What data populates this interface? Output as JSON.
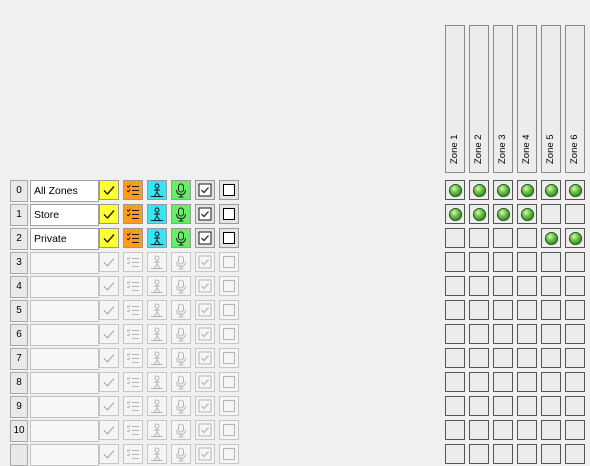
{
  "zones": [
    "Zone 1",
    "Zone 2",
    "Zone 3",
    "Zone 4",
    "Zone 5",
    "Zone 6"
  ],
  "rows": [
    {
      "index": "0",
      "name": "All Zones",
      "active": true,
      "zones": [
        true,
        true,
        true,
        true,
        true,
        true
      ]
    },
    {
      "index": "1",
      "name": "Store",
      "active": true,
      "zones": [
        true,
        true,
        true,
        true,
        false,
        false
      ]
    },
    {
      "index": "2",
      "name": "Private",
      "active": true,
      "zones": [
        false,
        false,
        false,
        false,
        true,
        true
      ]
    },
    {
      "index": "3",
      "name": "",
      "active": false,
      "zones": [
        false,
        false,
        false,
        false,
        false,
        false
      ]
    },
    {
      "index": "4",
      "name": "",
      "active": false,
      "zones": [
        false,
        false,
        false,
        false,
        false,
        false
      ]
    },
    {
      "index": "5",
      "name": "",
      "active": false,
      "zones": [
        false,
        false,
        false,
        false,
        false,
        false
      ]
    },
    {
      "index": "6",
      "name": "",
      "active": false,
      "zones": [
        false,
        false,
        false,
        false,
        false,
        false
      ]
    },
    {
      "index": "7",
      "name": "",
      "active": false,
      "zones": [
        false,
        false,
        false,
        false,
        false,
        false
      ]
    },
    {
      "index": "8",
      "name": "",
      "active": false,
      "zones": [
        false,
        false,
        false,
        false,
        false,
        false
      ]
    },
    {
      "index": "9",
      "name": "",
      "active": false,
      "zones": [
        false,
        false,
        false,
        false,
        false,
        false
      ]
    },
    {
      "index": "10",
      "name": "",
      "active": false,
      "zones": [
        false,
        false,
        false,
        false,
        false,
        false
      ]
    },
    {
      "index": "",
      "name": "",
      "active": false,
      "zones": [
        false,
        false,
        false,
        false,
        false,
        false
      ]
    }
  ],
  "icons": [
    "check-icon",
    "list-check-icon",
    "person-icon",
    "microphone-icon",
    "checkbox-icon",
    "square-icon"
  ],
  "colors": {
    "check_active": "#ffff33",
    "list_active": "#ff9d1a",
    "person_active": "#33e6f2",
    "mic_active": "#66ee66",
    "indicator_on": "#4caf3a"
  }
}
